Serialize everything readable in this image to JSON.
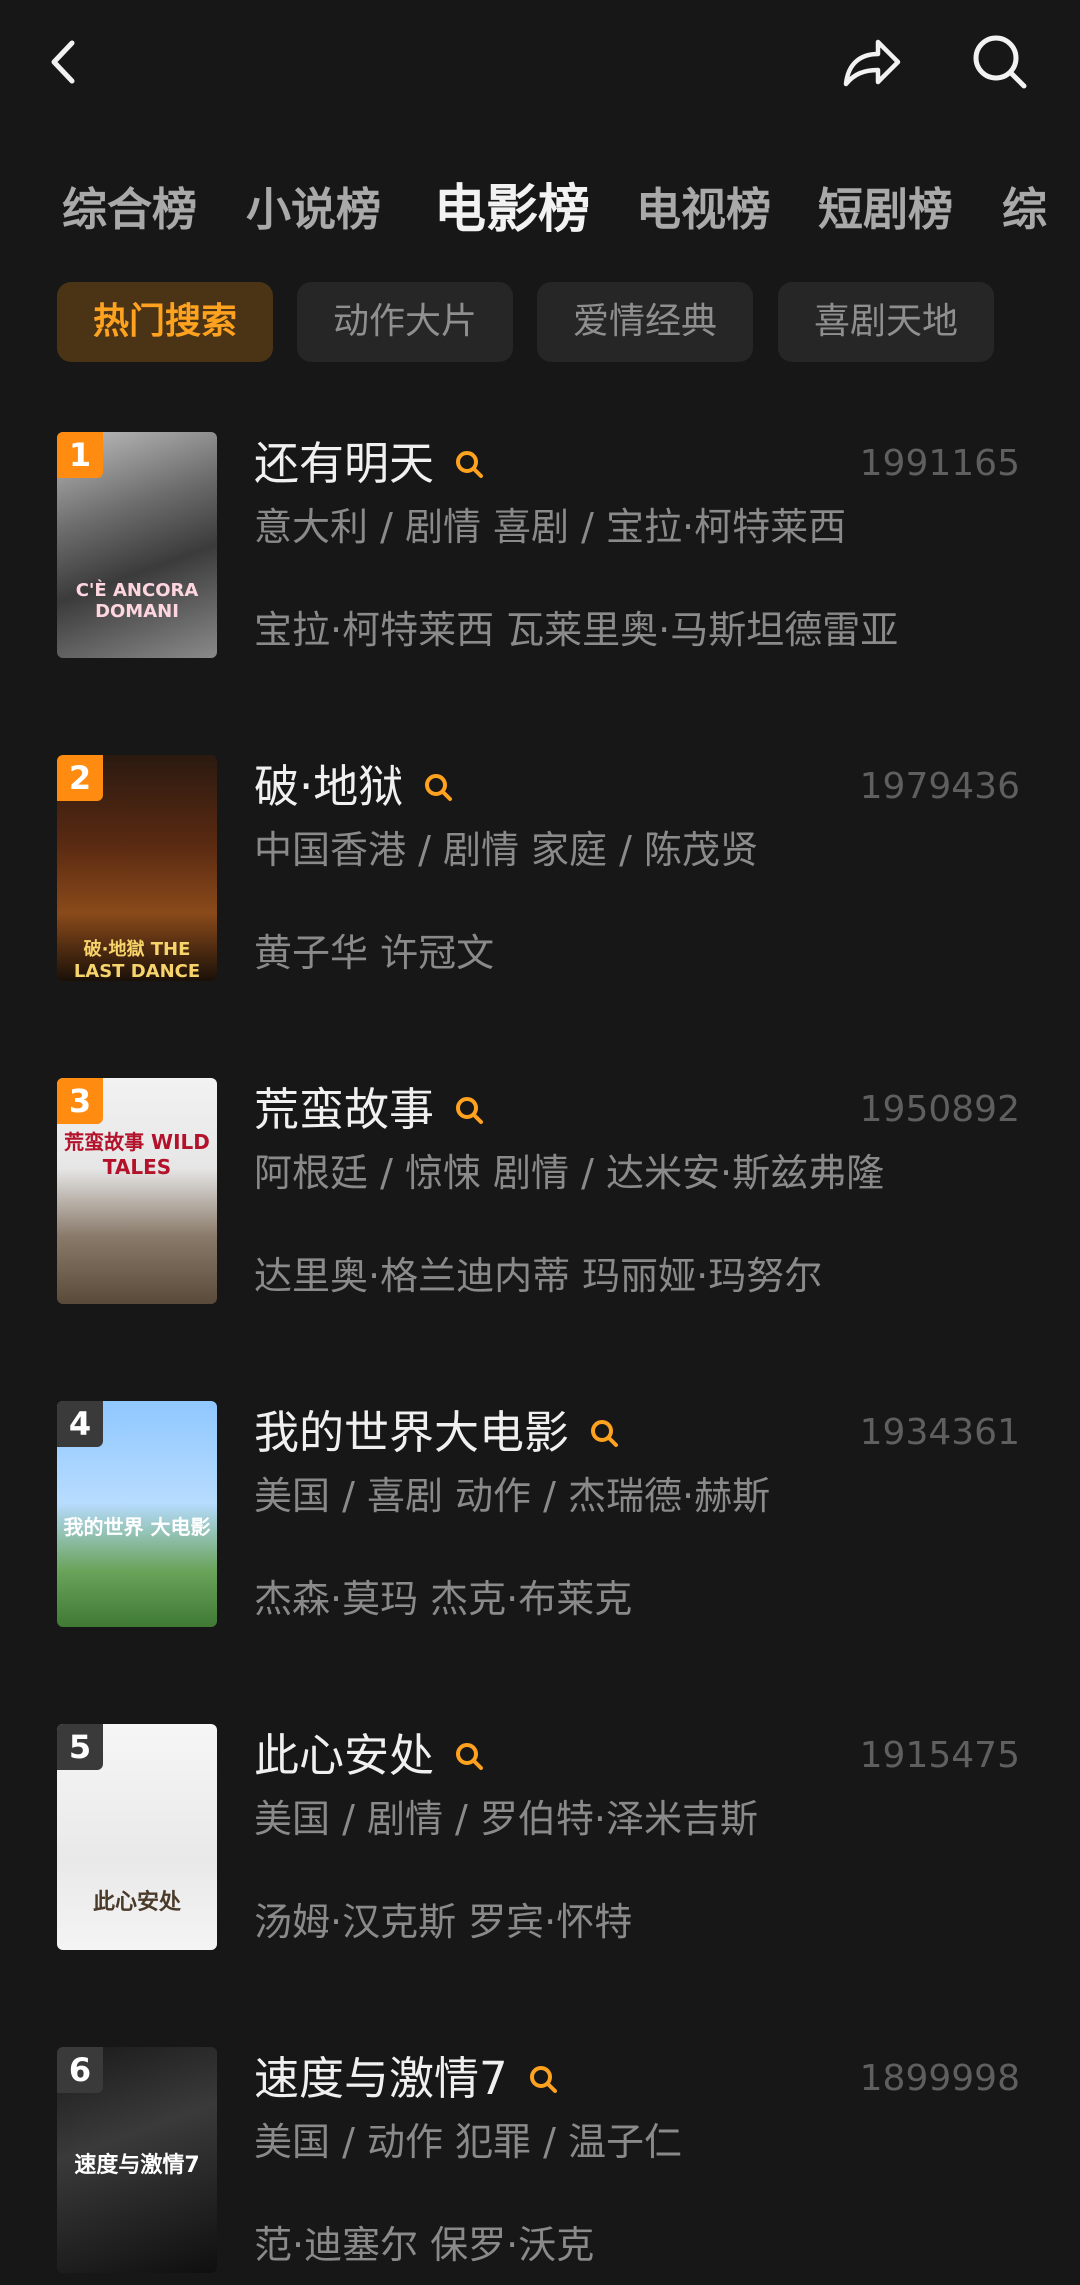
{
  "header": {
    "back_icon": "chevron-left-icon",
    "share_icon": "share-icon",
    "search_icon": "search-icon"
  },
  "tabs": [
    {
      "label": "综合榜"
    },
    {
      "label": "小说榜"
    },
    {
      "label": "电影榜",
      "active": true
    },
    {
      "label": "电视榜"
    },
    {
      "label": "短剧榜"
    },
    {
      "label": "综"
    }
  ],
  "chips": [
    {
      "label": "热门搜索",
      "active": true
    },
    {
      "label": "动作大片"
    },
    {
      "label": "爱情经典"
    },
    {
      "label": "喜剧天地"
    }
  ],
  "accent_color": "#ffa21f",
  "items": [
    {
      "rank": "1",
      "title": "还有明天",
      "hot": "1991165",
      "meta": "意大利 / 剧情 喜剧 / 宝拉·柯特莱西",
      "cast": "宝拉·柯特莱西 瓦莱里奥·马斯坦德雷亚",
      "poster_text": "C'È ANCORA DOMANI",
      "rank_color": "#ff8c10"
    },
    {
      "rank": "2",
      "title": "破·地狱",
      "hot": "1979436",
      "meta": "中国香港 / 剧情 家庭 / 陈茂贤",
      "cast": "黄子华 许冠文",
      "poster_text": "破·地獄 THE LAST DANCE",
      "rank_color": "#ff8c10"
    },
    {
      "rank": "3",
      "title": "荒蛮故事",
      "hot": "1950892",
      "meta": "阿根廷 / 惊悚 剧情 / 达米安·斯兹弗隆",
      "cast": "达里奥·格兰迪内蒂 玛丽娅·玛努尔",
      "poster_text": "荒蛮故事 WILD TALES",
      "rank_color": "#ff8c10"
    },
    {
      "rank": "4",
      "title": "我的世界大电影",
      "hot": "1934361",
      "meta": "美国 / 喜剧 动作 / 杰瑞德·赫斯",
      "cast": "杰森·莫玛 杰克·布莱克",
      "poster_text": "我的世界 大电影",
      "rank_color": "#3a3a3a"
    },
    {
      "rank": "5",
      "title": "此心安处",
      "hot": "1915475",
      "meta": "美国 / 剧情 / 罗伯特·泽米吉斯",
      "cast": "汤姆·汉克斯 罗宾·怀特",
      "poster_text": "此心安处",
      "rank_color": "#3a3a3a"
    },
    {
      "rank": "6",
      "title": "速度与激情7",
      "hot": "1899998",
      "meta": "美国 / 动作 犯罪 / 温子仁",
      "cast": "范·迪塞尔 保罗·沃克",
      "poster_text": "速度与激情7",
      "rank_color": "#3a3a3a"
    }
  ]
}
